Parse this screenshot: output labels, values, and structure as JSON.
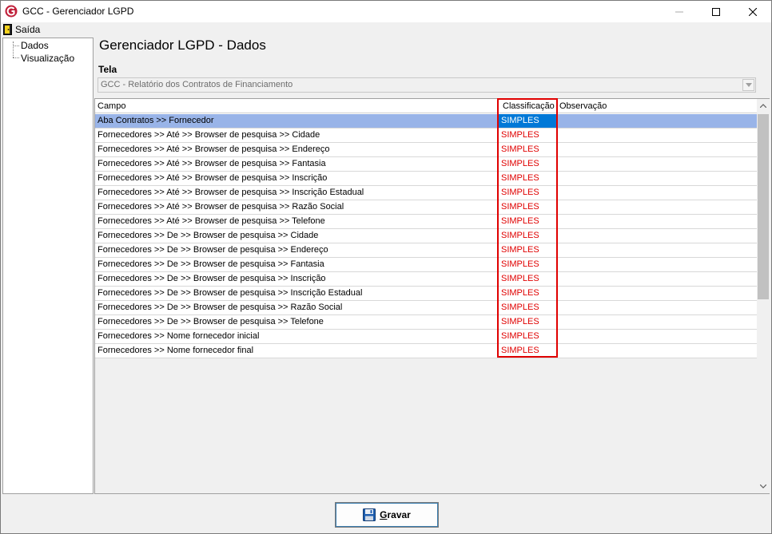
{
  "window": {
    "title": "GCC - Gerenciador LGPD"
  },
  "menu": {
    "exit_label": "Saída"
  },
  "tree": {
    "items": [
      "Dados",
      "Visualização"
    ]
  },
  "main": {
    "page_title": "Gerenciador LGPD - Dados",
    "tela_label": "Tela",
    "tela_value": "GCC - Relatório dos Contratos de Financiamento"
  },
  "grid": {
    "columns": [
      "Campo",
      "Classificação",
      "Observação"
    ],
    "rows": [
      {
        "campo": "Aba Contratos >> Fornecedor",
        "classificacao": "SIMPLES",
        "observacao": ""
      },
      {
        "campo": "Fornecedores >> Até >> Browser de pesquisa >> Cidade",
        "classificacao": "SIMPLES",
        "observacao": ""
      },
      {
        "campo": "Fornecedores >> Até >> Browser de pesquisa >> Endereço",
        "classificacao": "SIMPLES",
        "observacao": ""
      },
      {
        "campo": "Fornecedores >> Até >> Browser de pesquisa >> Fantasia",
        "classificacao": "SIMPLES",
        "observacao": ""
      },
      {
        "campo": "Fornecedores >> Até >> Browser de pesquisa >> Inscrição",
        "classificacao": "SIMPLES",
        "observacao": ""
      },
      {
        "campo": "Fornecedores >> Até >> Browser de pesquisa >> Inscrição Estadual",
        "classificacao": "SIMPLES",
        "observacao": ""
      },
      {
        "campo": "Fornecedores >> Até >> Browser de pesquisa >> Razão Social",
        "classificacao": "SIMPLES",
        "observacao": ""
      },
      {
        "campo": "Fornecedores >> Até >> Browser de pesquisa >> Telefone",
        "classificacao": "SIMPLES",
        "observacao": ""
      },
      {
        "campo": "Fornecedores >> De >> Browser de pesquisa >> Cidade",
        "classificacao": "SIMPLES",
        "observacao": ""
      },
      {
        "campo": "Fornecedores >> De >> Browser de pesquisa >> Endereço",
        "classificacao": "SIMPLES",
        "observacao": ""
      },
      {
        "campo": "Fornecedores >> De >> Browser de pesquisa >> Fantasia",
        "classificacao": "SIMPLES",
        "observacao": ""
      },
      {
        "campo": "Fornecedores >> De >> Browser de pesquisa >> Inscrição",
        "classificacao": "SIMPLES",
        "observacao": ""
      },
      {
        "campo": "Fornecedores >> De >> Browser de pesquisa >> Inscrição Estadual",
        "classificacao": "SIMPLES",
        "observacao": ""
      },
      {
        "campo": "Fornecedores >> De >> Browser de pesquisa >> Razão Social",
        "classificacao": "SIMPLES",
        "observacao": ""
      },
      {
        "campo": "Fornecedores >> De >> Browser de pesquisa >> Telefone",
        "classificacao": "SIMPLES",
        "observacao": ""
      },
      {
        "campo": "Fornecedores >> Nome fornecedor inicial",
        "classificacao": "SIMPLES",
        "observacao": ""
      },
      {
        "campo": "Fornecedores >> Nome fornecedor final",
        "classificacao": "SIMPLES",
        "observacao": ""
      }
    ]
  },
  "footer": {
    "save_label": "Gravar"
  },
  "colors": {
    "selected_row": "#99b4e8",
    "selected_cell": "#0078d7",
    "classification_text": "#e00000",
    "highlight_box": "#e00000"
  },
  "icons": {
    "app": "app-logo-icon",
    "exit": "exit-door-icon",
    "save": "floppy-disk-icon"
  }
}
